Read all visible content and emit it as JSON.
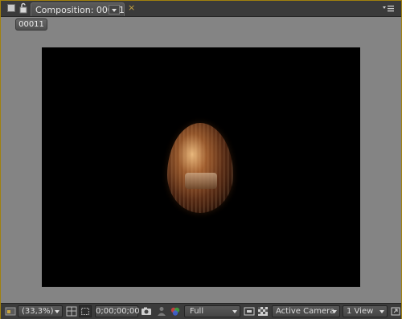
{
  "panel": {
    "tab_title": "Composition: 00011",
    "breadcrumb": "00011"
  },
  "toolbar": {
    "zoom_value": "(33,3%)",
    "timecode": "0;00;00;00",
    "resolution": "Full",
    "camera": "Active Camera",
    "view_layout": "1 View"
  },
  "colors": {
    "panel_border": "#a0810d",
    "panel_bg": "#848484",
    "viewer_bg": "#000000"
  },
  "icons": {
    "tab_lock": "lock-icon",
    "panel_menu": "panel-menu-icon",
    "always_preview": "preview-icon",
    "grid": "grid-icon",
    "roi": "region-of-interest-icon",
    "snapshot": "camera-icon",
    "show_snapshot": "person-icon",
    "channel": "rgb-channel-icon",
    "fast_preview": "fast-preview-icon",
    "transparency_grid": "transparency-grid-icon",
    "expand": "expand-icon"
  }
}
